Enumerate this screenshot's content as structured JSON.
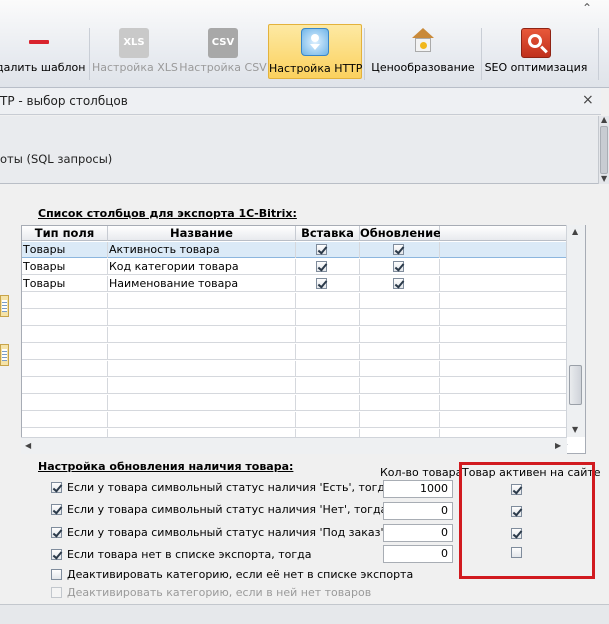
{
  "toolbar": {
    "buttons": [
      {
        "label": "далить шаблон",
        "icon": "minus-icon",
        "state": "normal"
      },
      {
        "label": "Настройка XLS",
        "icon_text": "XLS",
        "icon": "xls-icon",
        "state": "disabled"
      },
      {
        "label": "Настройка CSV",
        "icon_text": "CSV",
        "icon": "csv-icon",
        "state": "disabled"
      },
      {
        "label": "Настройка HTTP",
        "icon": "http-download-icon",
        "state": "active"
      },
      {
        "label": "Ценообразование",
        "icon": "house-price-icon",
        "state": "normal"
      },
      {
        "label": "SEO оптимизация",
        "icon": "seo-search-icon",
        "state": "normal"
      }
    ]
  },
  "panel": {
    "title": "TP - выбор столбцов",
    "close_label": "×",
    "subtitle": "оты (SQL запросы)"
  },
  "columns_section": {
    "title": "Список столбцов для экспорта 1С-Bitrix:",
    "headers": [
      "Тип поля",
      "Название",
      "Вставка",
      "Обновление"
    ],
    "rows": [
      {
        "type": "Товары",
        "name": "Активность товара",
        "insert": true,
        "update": true
      },
      {
        "type": "Товары",
        "name": "Код категории товара",
        "insert": true,
        "update": true
      },
      {
        "type": "Товары",
        "name": "Наименование товара",
        "insert": true,
        "update": true
      }
    ]
  },
  "availability_section": {
    "title": "Настройка обновления наличия товара:",
    "qty_header": "Кол-во товара",
    "active_header": "Товар активен на сайте",
    "options": [
      {
        "label": "Если у товара символьный статус наличия 'Есть', тогда",
        "checked": true,
        "qty": "1000",
        "active": true,
        "enabled": true
      },
      {
        "label": "Если у товара символьный статус наличия 'Нет', тогда",
        "checked": true,
        "qty": "0",
        "active": true,
        "enabled": true
      },
      {
        "label": "Если у товара символьный статус наличия 'Под заказ', тогда",
        "checked": true,
        "qty": "0",
        "active": true,
        "enabled": true
      },
      {
        "label": "Если товара нет в списке экспорта, тогда",
        "checked": true,
        "qty": "0",
        "active": false,
        "enabled": true
      },
      {
        "label": "Деактивировать категорию, если её нет в списке экспорта",
        "checked": false,
        "enabled": true
      },
      {
        "label": "Деактивировать категорию, если в ней нет товаров",
        "checked": false,
        "enabled": false
      }
    ]
  },
  "colors": {
    "highlight": "#d11a1f",
    "selected_row": "#dbeaf7",
    "active_button": "#fbd15e"
  }
}
